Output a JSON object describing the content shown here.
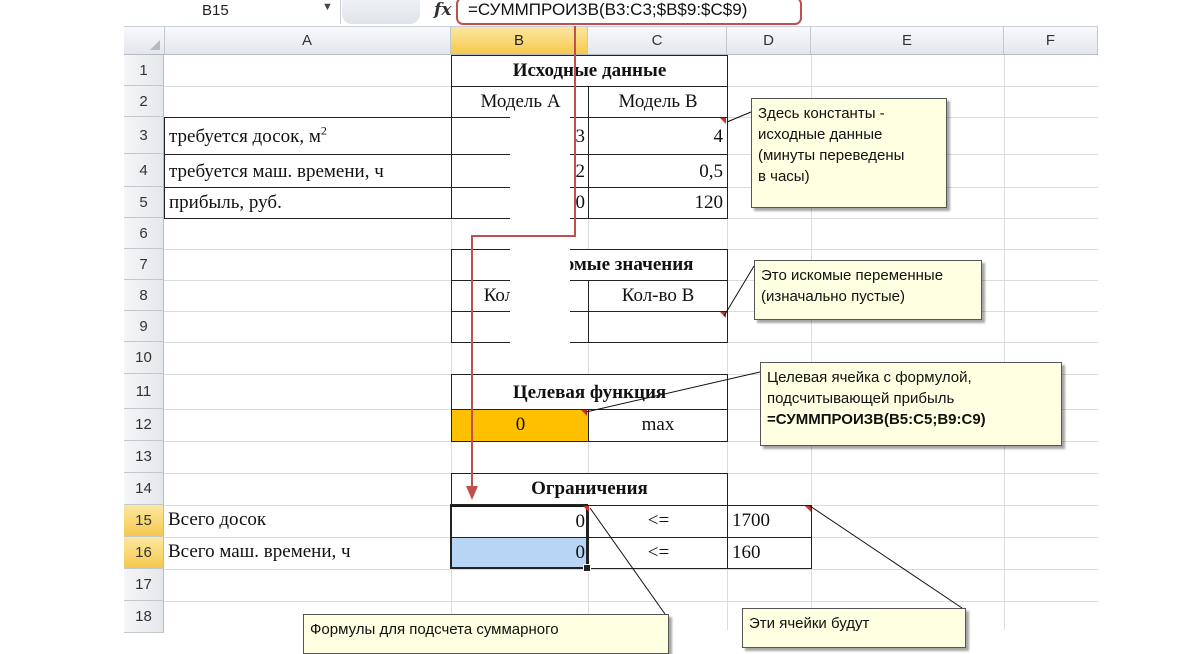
{
  "formula_bar": {
    "name_box": "B15",
    "fx_icon": "fx-icon",
    "formula": "=СУММПРОИЗВ(B3:C3;$B$9:$C$9)"
  },
  "columns": [
    "A",
    "B",
    "C",
    "D",
    "E",
    "F"
  ],
  "active_column": "B",
  "rows": [
    "1",
    "2",
    "3",
    "4",
    "5",
    "6",
    "7",
    "8",
    "9",
    "10",
    "11",
    "12",
    "13",
    "14",
    "15",
    "16",
    "17",
    "18"
  ],
  "active_rows": [
    "15",
    "16"
  ],
  "sheet": {
    "source_header": "Исходные данные",
    "model_a": "Модель А",
    "model_b": "Модель В",
    "row3_label": "требуется досок, м",
    "row3_sup": "2",
    "row4_label": "требуется маш. времени, ч",
    "row5_label": "прибыль, руб.",
    "row3_b": "3",
    "row4_b": "2",
    "row5_b": "0",
    "row3_c": "4",
    "row4_c": "0,5",
    "row5_c": "120",
    "sought_header": "скомые значения",
    "count_a": "Кол-во А",
    "count_b": "Кол-во В",
    "target_header": "Целевая функция",
    "target_value": "0",
    "target_goal": "max",
    "constraints_header": "Ограничения",
    "row15_label": "Всего досок",
    "row16_label": "Всего маш. времени, ч",
    "row15_b": "0",
    "row16_b": "0",
    "row15_c": "<=",
    "row16_c": "<=",
    "row15_d": "1700",
    "row16_d": "160"
  },
  "notes": {
    "constants": [
      "Здесь константы -",
      "исходные данные",
      "(минуты переведены",
      "в часы)"
    ],
    "variables": [
      "Это искомые переменные",
      "(изначально пустые)"
    ],
    "target": [
      "Целевая ячейка с формулой,",
      "подсчитывающей прибыль",
      "=СУММПРОИЗВ(B5:C5;B9:C9)"
    ],
    "formulas": [
      "Формулы для подсчета суммарного"
    ],
    "these_cells": [
      "Эти ячейки будут"
    ]
  },
  "colors": {
    "arrow": "#c0504d",
    "target_fill": "#ffc000",
    "selection_fill": "#b8d5f5",
    "note_fill": "#ffffe1",
    "active_header": "#f6c94c"
  }
}
